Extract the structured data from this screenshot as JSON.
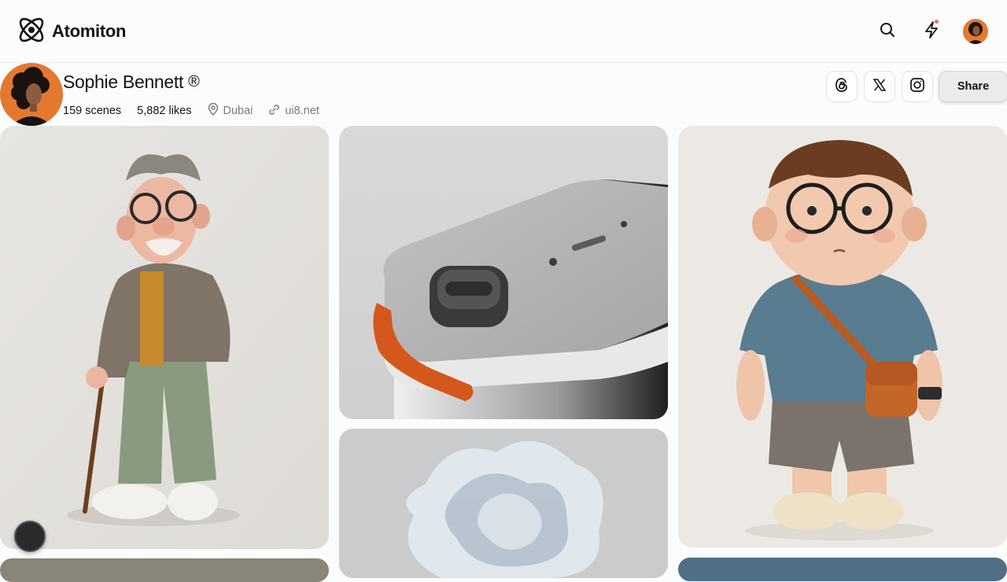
{
  "header": {
    "brand_name": "Atomiton",
    "icons": [
      "atom-logo-icon",
      "search-icon",
      "lightning-icon",
      "user-avatar"
    ],
    "notification_dot_color": "#f16d4c"
  },
  "profile": {
    "name": "Sophie Bennett",
    "reg_mark": "®",
    "scenes": "159 scenes",
    "likes": "5,882 likes",
    "location": "Dubai",
    "website": "ui8.net",
    "avatar_bg": "#e5782f"
  },
  "socials": {
    "items": [
      "threads-icon",
      "x-icon",
      "instagram-icon"
    ],
    "share_label": "Share"
  },
  "gallery": {
    "cards": [
      {
        "name": "old-man-character-card",
        "subject": "elderly man with cane"
      },
      {
        "name": "product-device-card",
        "subject": "aluminium device with orange handle"
      },
      {
        "name": "boy-character-card",
        "subject": "boy with glasses and orange bag"
      },
      {
        "name": "abstract-flower-card",
        "subject": "translucent flower"
      },
      {
        "name": "bottom-left-card",
        "subject": "partial image"
      },
      {
        "name": "bottom-right-card",
        "subject": "partial image"
      }
    ]
  }
}
